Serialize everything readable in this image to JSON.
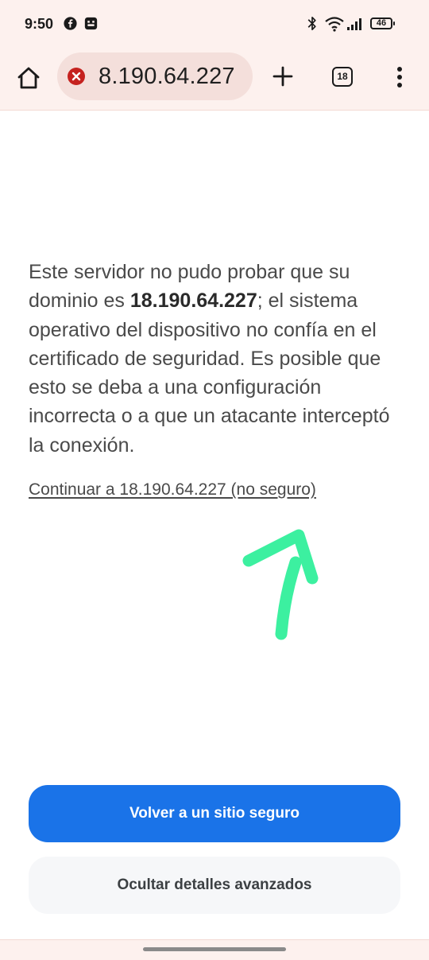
{
  "status_bar": {
    "time": "9:50",
    "app_icons": [
      "facebook-icon",
      "app-icon"
    ],
    "right_icons": [
      "bluetooth-icon",
      "wifi-icon",
      "signal-icon"
    ],
    "battery": "46"
  },
  "toolbar": {
    "url": "8.190.64.227",
    "tab_count": "18",
    "security_state": "not-secure"
  },
  "content": {
    "text_before": "Este servidor no pudo probar que su dominio es ",
    "domain": "18.190.64.227",
    "text_after": "; el sistema operativo del dispositivo no confía en el certificado de seguridad. Es posible que esto se deba a una configuración incorrecta o a que un atacante interceptó la conexión.",
    "proceed_link": "Continuar a 18.190.64.227 (no seguro)"
  },
  "buttons": {
    "back_to_safety": "Volver a un sitio seguro",
    "hide_advanced": "Ocultar detalles avanzados"
  },
  "colors": {
    "primary": "#1a73e8",
    "error": "#c5221f",
    "annotation": "#3cf0a0",
    "toolbar_bg": "#fdf1ee"
  }
}
